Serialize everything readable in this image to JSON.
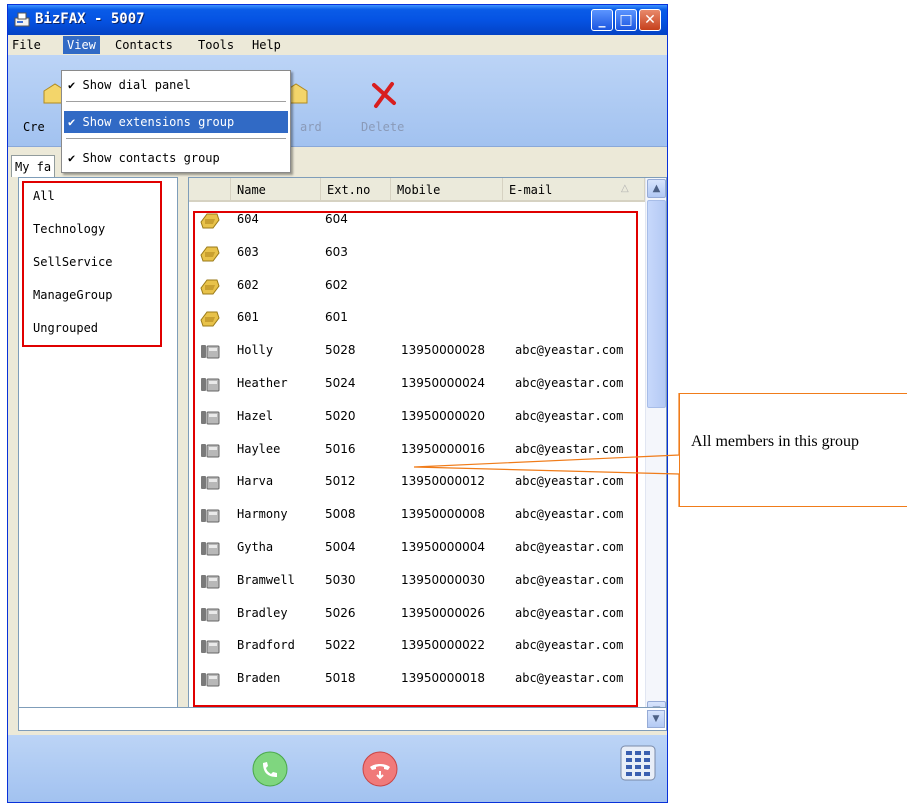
{
  "window": {
    "title": "BizFAX - 5007",
    "controls": [
      "minimize-icon",
      "maximize-icon",
      "close-icon"
    ]
  },
  "menubar": {
    "items": [
      {
        "label": "File"
      },
      {
        "label": "View",
        "active": true
      },
      {
        "label": "Contacts"
      },
      {
        "label": "Tools"
      },
      {
        "label": "Help"
      }
    ]
  },
  "view_menu": {
    "items": [
      {
        "label": "Show dial panel",
        "checked": true,
        "highlighted": false
      },
      {
        "label": "Show extensions group",
        "checked": true,
        "highlighted": true
      },
      {
        "label": "Show contacts group",
        "checked": true,
        "highlighted": false
      }
    ],
    "check_glyph": "✔"
  },
  "toolbar": {
    "create_label_visible": "Cre",
    "forward_label_visible": "ard",
    "delete_label": "Delete"
  },
  "tab": {
    "label_visible": "My fa"
  },
  "groups": [
    "All",
    "Technology",
    "SellService",
    "ManageGroup",
    "Ungrouped"
  ],
  "list": {
    "columns": [
      "Name",
      "Ext.no",
      "Mobile",
      "E-mail"
    ],
    "rows": [
      {
        "kind": "extension",
        "name": "604",
        "ext": "604",
        "mobile": "",
        "email": ""
      },
      {
        "kind": "extension",
        "name": "603",
        "ext": "603",
        "mobile": "",
        "email": ""
      },
      {
        "kind": "extension",
        "name": "602",
        "ext": "602",
        "mobile": "",
        "email": ""
      },
      {
        "kind": "extension",
        "name": "601",
        "ext": "601",
        "mobile": "",
        "email": ""
      },
      {
        "kind": "contact",
        "name": "Holly",
        "ext": "5028",
        "mobile": "13950000028",
        "email": "abc@yeastar.com"
      },
      {
        "kind": "contact",
        "name": "Heather",
        "ext": "5024",
        "mobile": "13950000024",
        "email": "abc@yeastar.com"
      },
      {
        "kind": "contact",
        "name": "Hazel",
        "ext": "5020",
        "mobile": "13950000020",
        "email": "abc@yeastar.com"
      },
      {
        "kind": "contact",
        "name": "Haylee",
        "ext": "5016",
        "mobile": "13950000016",
        "email": "abc@yeastar.com"
      },
      {
        "kind": "contact",
        "name": "Harva",
        "ext": "5012",
        "mobile": "13950000012",
        "email": "abc@yeastar.com"
      },
      {
        "kind": "contact",
        "name": "Harmony",
        "ext": "5008",
        "mobile": "13950000008",
        "email": "abc@yeastar.com"
      },
      {
        "kind": "contact",
        "name": "Gytha",
        "ext": "5004",
        "mobile": "13950000004",
        "email": "abc@yeastar.com"
      },
      {
        "kind": "contact",
        "name": "Bramwell",
        "ext": "5030",
        "mobile": "13950000030",
        "email": "abc@yeastar.com"
      },
      {
        "kind": "contact",
        "name": "Bradley",
        "ext": "5026",
        "mobile": "13950000026",
        "email": "abc@yeastar.com"
      },
      {
        "kind": "contact",
        "name": "Bradford",
        "ext": "5022",
        "mobile": "13950000022",
        "email": "abc@yeastar.com"
      },
      {
        "kind": "contact",
        "name": "Braden",
        "ext": "5018",
        "mobile": "13950000018",
        "email": "abc@yeastar.com"
      }
    ]
  },
  "callout": {
    "text": "All members in this group"
  },
  "colors": {
    "annotation_red": "#e00000",
    "callout_orange": "#f07c1a",
    "menu_highlight": "#316ac5",
    "call_green": "#5cc25c",
    "hangup_red": "#e84a4a"
  }
}
